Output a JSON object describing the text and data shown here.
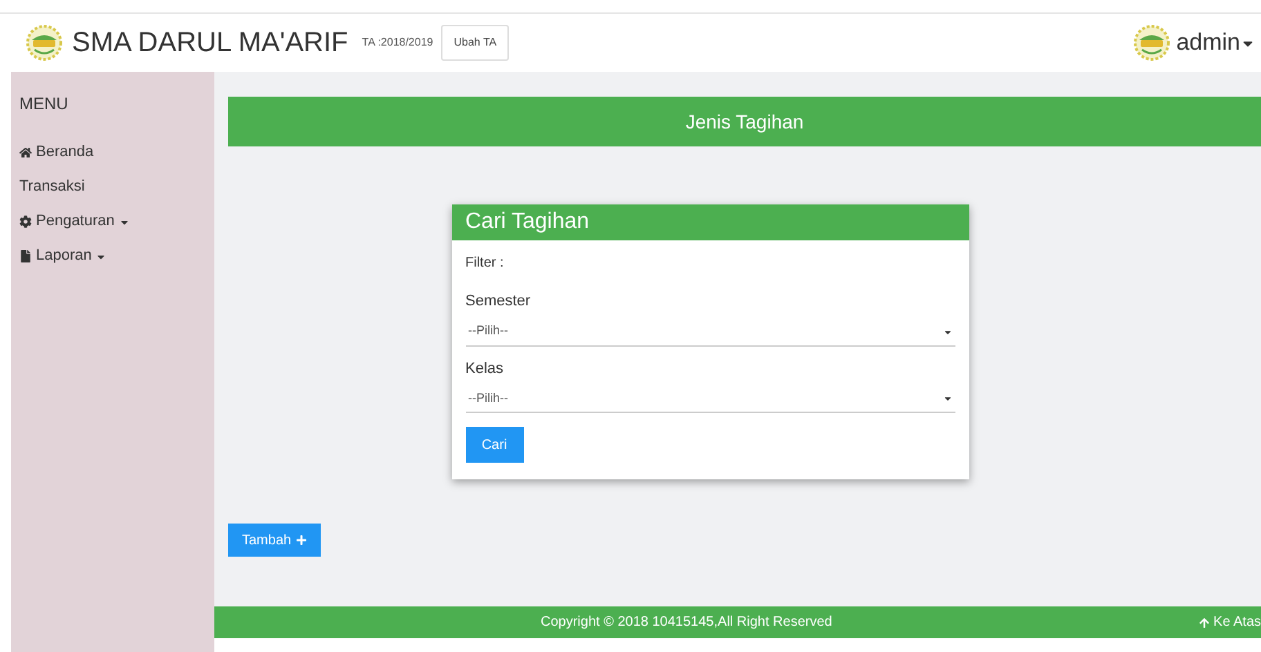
{
  "header": {
    "title": "SMA DARUL MA'ARIF",
    "academic_year": "TA :2018/2019",
    "change_year_button": "Ubah TA",
    "user": "admin"
  },
  "sidebar": {
    "heading": "MENU",
    "items": [
      {
        "label": "Beranda",
        "kind": "home",
        "dropdown": false
      },
      {
        "label": "Transaksi",
        "kind": "plain",
        "dropdown": false
      },
      {
        "label": "Pengaturan",
        "kind": "settings",
        "dropdown": true
      },
      {
        "label": "Laporan",
        "kind": "report",
        "dropdown": true
      }
    ]
  },
  "banner": {
    "title": "Jenis Tagihan"
  },
  "card": {
    "title": "Cari Tagihan",
    "filter_label": "Filter :",
    "fields": [
      {
        "label": "Semester",
        "value": "--Pilih--"
      },
      {
        "label": "Kelas",
        "value": "--Pilih--"
      }
    ],
    "button": "Cari"
  },
  "add_button": "Tambah",
  "footer": {
    "copyright": "Copyright © 2018 10415145,All Right Reserved",
    "back_to_top": "Ke Atas"
  }
}
